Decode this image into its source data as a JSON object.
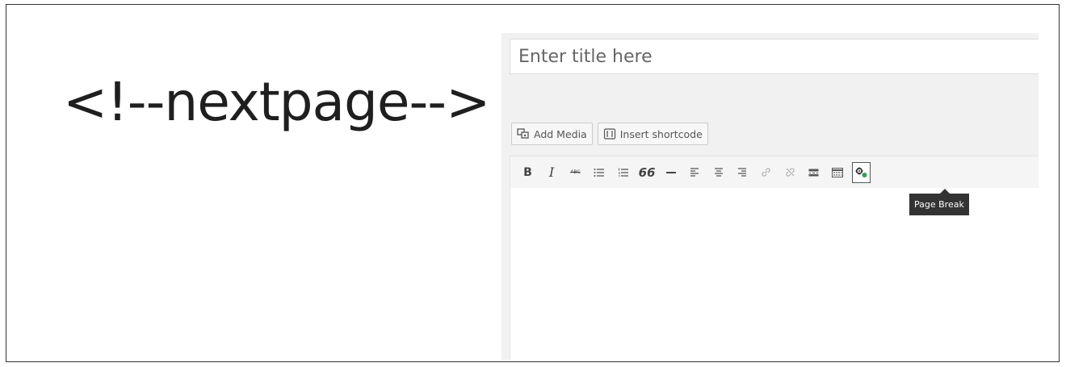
{
  "heading": {
    "code_text": "<!--nextpage-->"
  },
  "editor": {
    "title_placeholder": "Enter title here",
    "media_buttons": {
      "add_media_label": "Add Media",
      "insert_shortcode_label": "Insert shortcode"
    },
    "toolbar": {
      "bold_label": "B",
      "italic_label": "I",
      "strikethrough_label": "ABC",
      "blockquote_label": "66",
      "icons": [
        "bold-icon",
        "italic-icon",
        "strikethrough-icon",
        "bulleted-list-icon",
        "numbered-list-icon",
        "blockquote-icon",
        "horizontal-line-icon",
        "align-left-icon",
        "align-center-icon",
        "align-right-icon",
        "insert-link-icon",
        "remove-link-icon",
        "read-more-icon",
        "toolbar-toggle-icon",
        "page-break-icon"
      ],
      "active_button": "page-break"
    },
    "tooltip": {
      "text": "Page Break"
    }
  },
  "colors": {
    "accent": "#2ea44f",
    "tooltip_bg": "#333333"
  }
}
